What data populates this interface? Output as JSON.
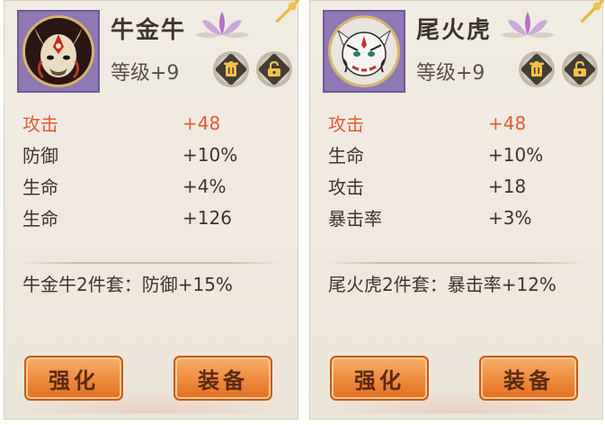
{
  "cards": [
    {
      "name": "牛金牛",
      "level": "等级+9",
      "stats": [
        {
          "label": "攻击",
          "value": "+48",
          "main": true
        },
        {
          "label": "防御",
          "value": "+10%",
          "main": false
        },
        {
          "label": "生命",
          "value": "+4%",
          "main": false
        },
        {
          "label": "生命",
          "value": "+126",
          "main": false
        }
      ],
      "set_bonus": "牛金牛2件套：防御+15%",
      "buttons": {
        "enhance": "强化",
        "equip": "装备"
      }
    },
    {
      "name": "尾火虎",
      "level": "等级+9",
      "stats": [
        {
          "label": "攻击",
          "value": "+48",
          "main": true
        },
        {
          "label": "生命",
          "value": "+10%",
          "main": false
        },
        {
          "label": "攻击",
          "value": "+18",
          "main": false
        },
        {
          "label": "暴击率",
          "value": "+3%",
          "main": false
        }
      ],
      "set_bonus": "尾火虎2件套：暴击率+12%",
      "buttons": {
        "enhance": "强化",
        "equip": "装备"
      }
    }
  ],
  "icons": {
    "trash": "trash-icon",
    "lock": "unlock-icon",
    "lotus": "lotus-icon"
  },
  "colors": {
    "main_stat": "#e05b3a",
    "button": "#ee8a3d",
    "frame": "#8f78b3"
  }
}
